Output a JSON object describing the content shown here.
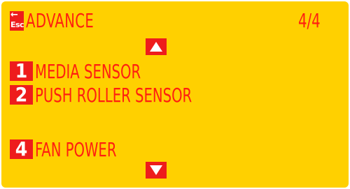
{
  "colors": {
    "background": "#ffd000",
    "accent": "#ee1c1c",
    "text": "#ff1e10",
    "key_text": "#ffffff"
  },
  "header": {
    "esc_key": {
      "arrow": "←",
      "label": "Esc"
    },
    "title": "ADVANCE",
    "page_indicator": "4/4"
  },
  "navigation": {
    "up_icon": "triangle-up-icon",
    "down_icon": "triangle-down-icon"
  },
  "menu": {
    "items": [
      {
        "key": "1",
        "label": "MEDIA SENSOR"
      },
      {
        "key": "2",
        "label": "PUSH ROLLER SENSOR"
      },
      {
        "key": "4",
        "label": "FAN POWER"
      }
    ]
  }
}
